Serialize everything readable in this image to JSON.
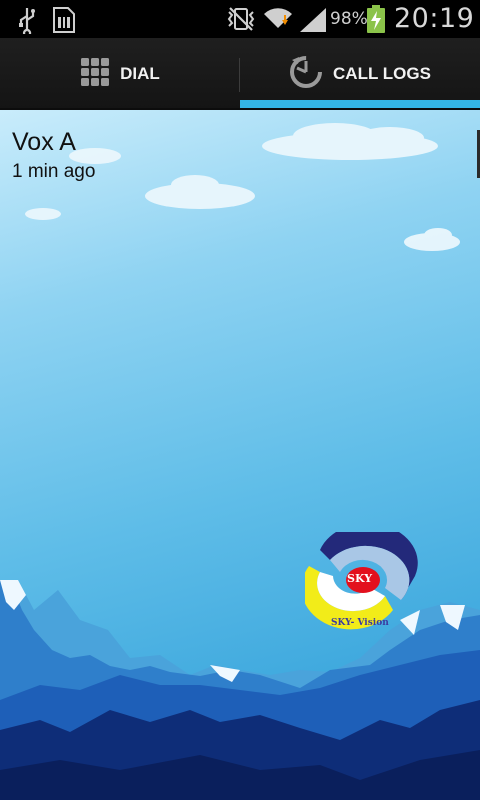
{
  "status_bar": {
    "icons": [
      "usb-icon",
      "sim-card-icon",
      "vibrate-icon",
      "wifi-icon",
      "signal-icon",
      "battery-charging-icon"
    ],
    "battery_percent": "98%",
    "time": "20:19"
  },
  "tabs": [
    {
      "label": "DIAL",
      "icon": "dialpad-icon",
      "selected": false
    },
    {
      "label": "CALL LOGS",
      "icon": "call-log-icon",
      "selected": true
    }
  ],
  "call_log": {
    "entries": [
      {
        "name": "Vox A",
        "time": "1 min ago"
      }
    ]
  },
  "logo": {
    "badge_text": "SKY",
    "caption": "SKY- Vision"
  },
  "colors": {
    "accent": "#33b5e5",
    "tabbar": "#1a1a1a",
    "battery": "#8bc34a"
  }
}
